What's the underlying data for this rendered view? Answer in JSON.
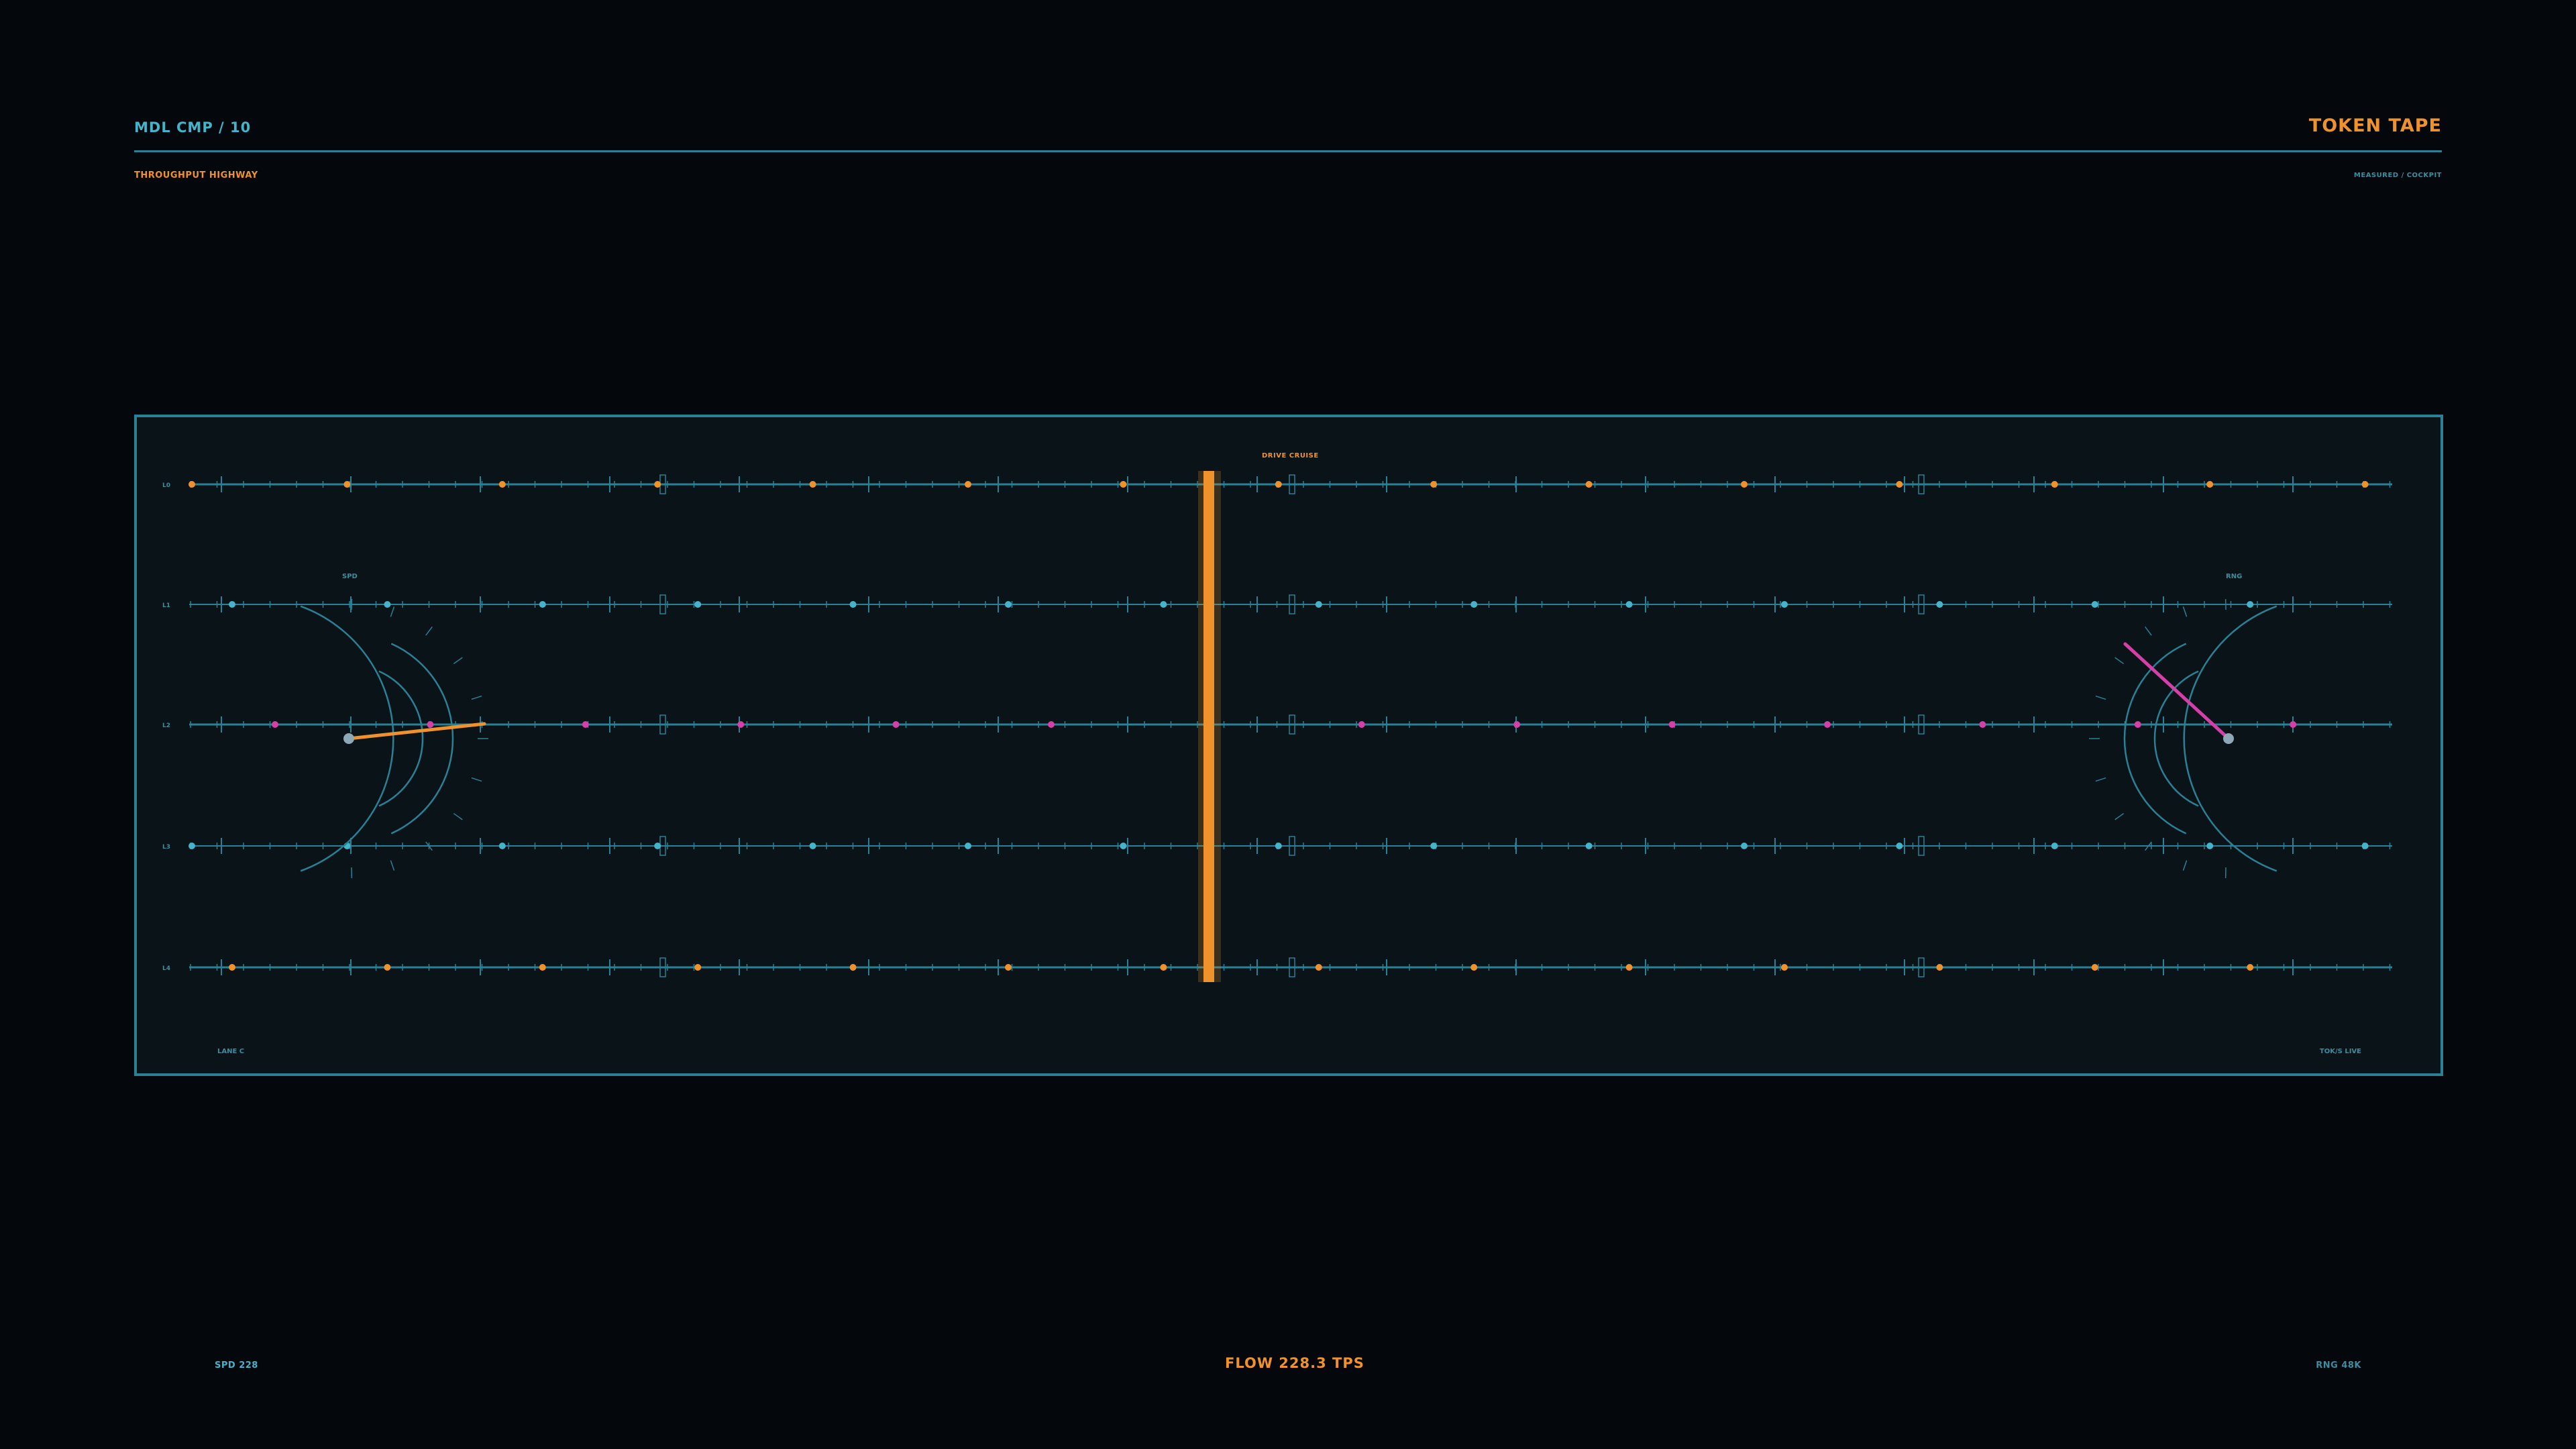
{
  "header": {
    "title_left": "MDL CMP / 10",
    "title_right": "TOKEN TAPE",
    "subtitle_left": "THROUGHPUT HIGHWAY",
    "subtitle_right": "MEASURED / COCKPIT"
  },
  "panel": {
    "marker_label": "DRIVE  CRUISE",
    "bottom_left": "LANE C",
    "bottom_right": "TOK/S LIVE",
    "gauge_left_label": "SPD",
    "gauge_right_label": "RNG",
    "lanes": [
      {
        "label": "L0",
        "dot_color": "#f0922c"
      },
      {
        "label": "L1",
        "dot_color": "#45b3c9"
      },
      {
        "label": "L2",
        "dot_color": "#d63fa8"
      },
      {
        "label": "L3",
        "dot_color": "#45b3c9"
      },
      {
        "label": "L4",
        "dot_color": "#f0922c"
      }
    ]
  },
  "footer": {
    "left": "SPD 228",
    "center": "FLOW  228.3 TPS",
    "right": "RNG 48K"
  },
  "colors": {
    "accent": "#f0922c",
    "cyan": "#45b3c9",
    "magenta": "#d63fa8",
    "line": "#2a8196"
  }
}
